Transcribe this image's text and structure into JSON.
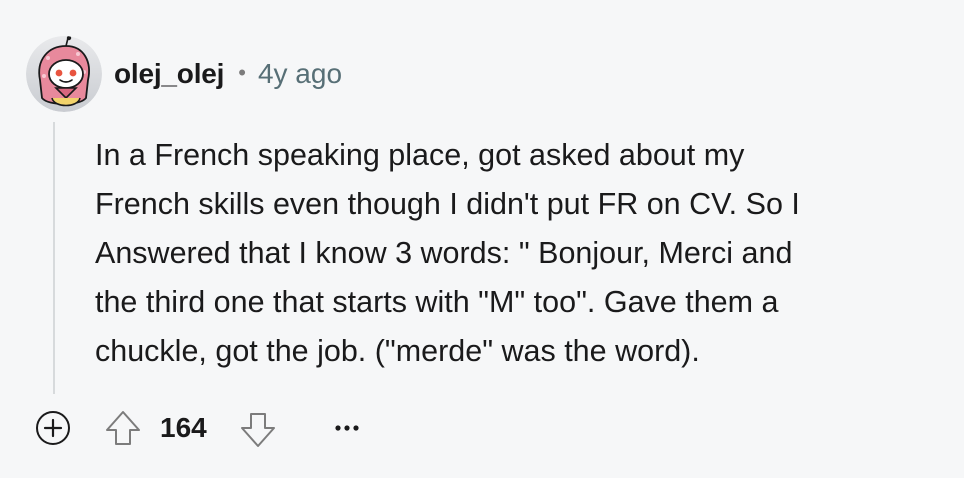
{
  "comment": {
    "username": "olej_olej",
    "separator": "•",
    "time_ago": "4y ago",
    "body": "In a French speaking place, got asked about my\nFrench skills even though I didn't put FR on CV. So I\nAnswered that I know 3 words: \" Bonjour, Merci and\nthe third one that starts with \"M\" too\". Gave them a\nchuckle, got the job. (\"merde\" was the word).",
    "score": "164"
  },
  "icons": {
    "avatar": "snoo-avatar",
    "expand": "plus-circle-icon",
    "upvote": "upvote-arrow-icon",
    "downvote": "downvote-arrow-icon",
    "more": "ellipsis-icon"
  },
  "colors": {
    "background": "#f6f7f8",
    "text": "#1a1a1b",
    "meta": "#576f76",
    "thread_line": "#d7dadc",
    "avatar_headscarf": "#e8899c"
  }
}
